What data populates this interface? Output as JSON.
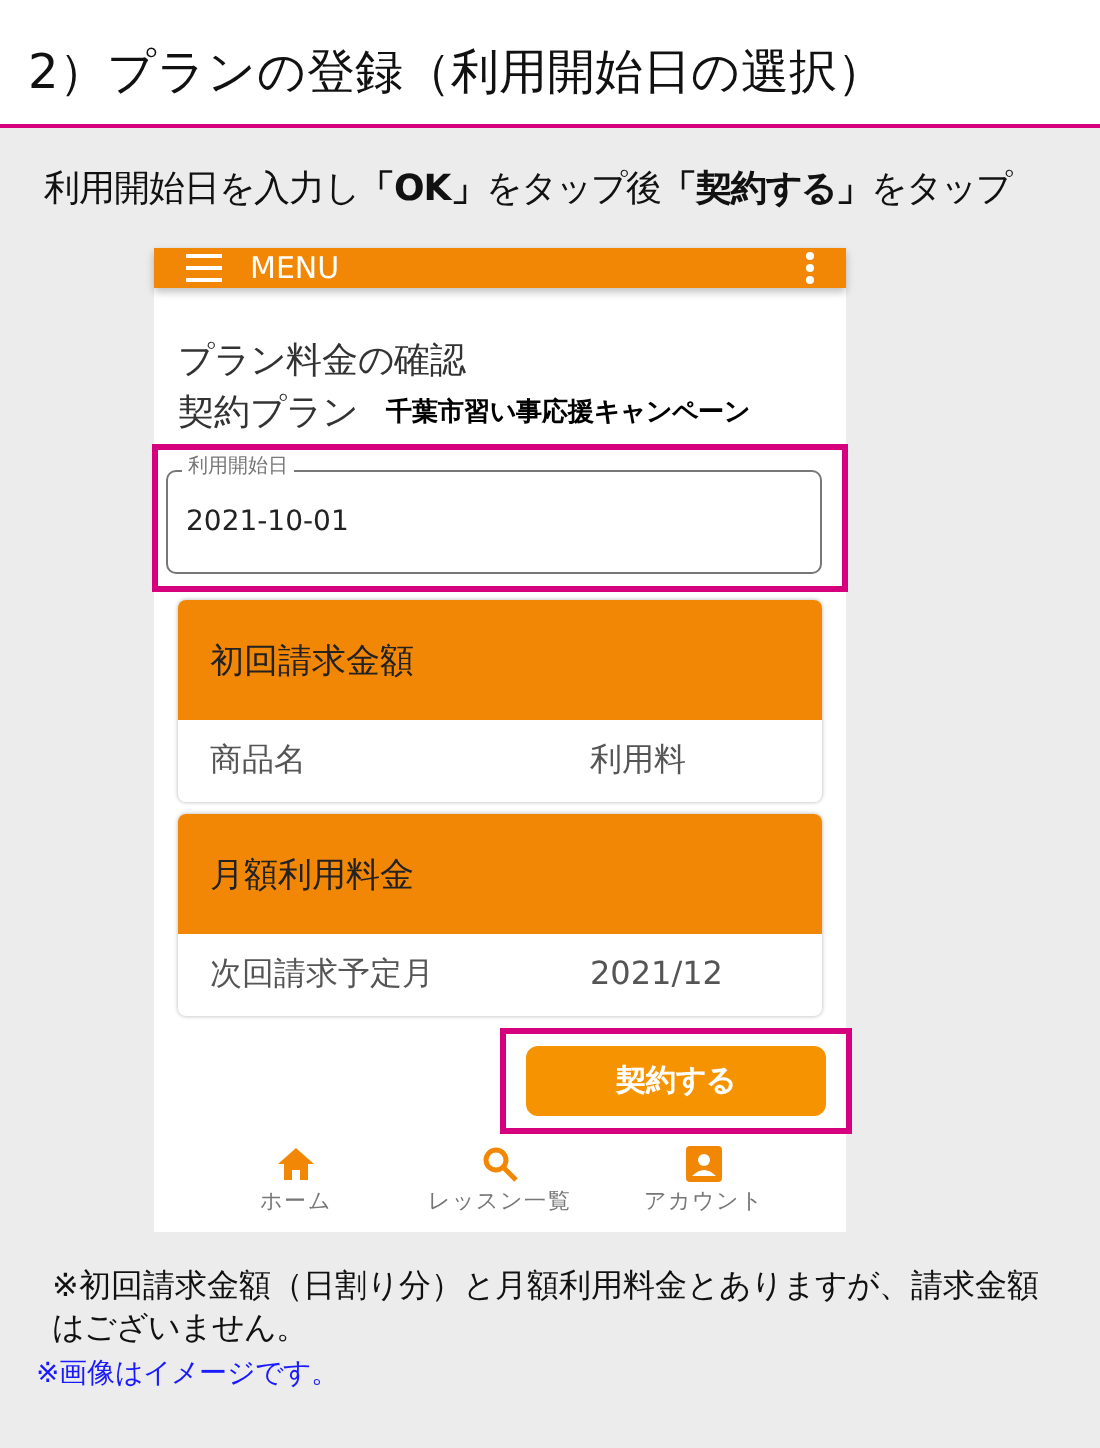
{
  "heading": "2）プランの登録（利用開始日の選択）",
  "instruction": "利用開始日を入力し**「OK」**をタップ後**「契約する」**をタップ",
  "phone": {
    "app_bar": {
      "title": "MENU"
    },
    "page_title": "プラン料金の確認",
    "plan": {
      "label": "契約プラン",
      "value": "千葉市習い事応援キャンペーン"
    },
    "start_date_field": {
      "label": "利用開始日",
      "value": "2021-10-01",
      "highlighted": true
    },
    "sections": [
      {
        "title": "初回請求金額",
        "row": [
          "商品名",
          "利用料"
        ]
      },
      {
        "title": "月額利用料金",
        "row": [
          "次回請求予定月",
          "2021/12"
        ]
      }
    ],
    "contract_button": {
      "label": "契約する",
      "highlighted": true
    },
    "nav": [
      {
        "kind": "home",
        "label": "ホーム"
      },
      {
        "kind": "search",
        "label": "レッスン一覧"
      },
      {
        "kind": "account",
        "label": "アカウント"
      }
    ]
  },
  "note": "※初回請求金額（日割り分）と月額利用料金とありますが、請求金額はございません。",
  "image_note": "※画像はイメージです。"
}
